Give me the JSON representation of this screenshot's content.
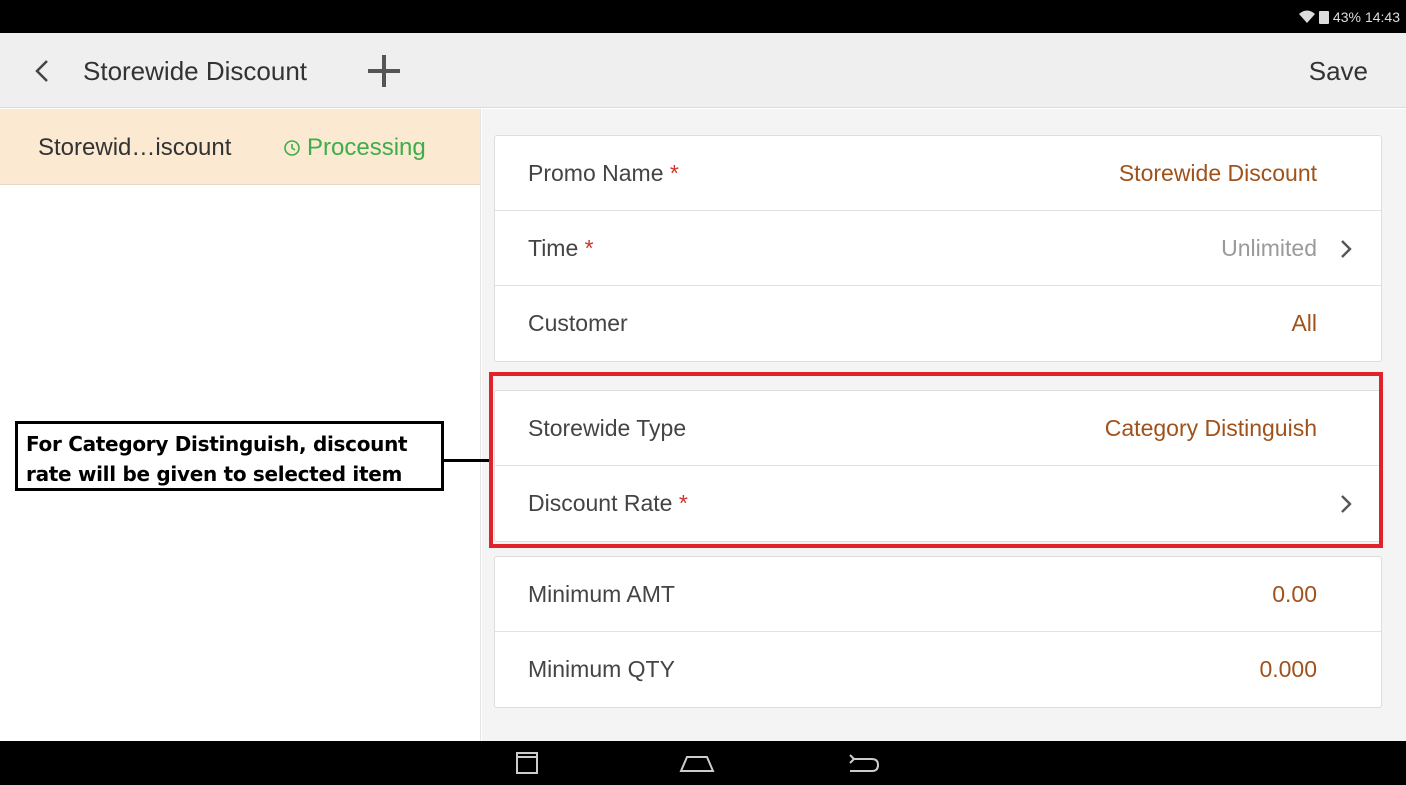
{
  "status_bar": {
    "battery": "43%",
    "time": "14:43"
  },
  "app_bar": {
    "title": "Storewide Discount",
    "save_label": "Save"
  },
  "list": {
    "items": [
      {
        "name": "Storewid…iscount",
        "status": "Processing"
      }
    ]
  },
  "form": {
    "group1": [
      {
        "label": "Promo Name",
        "required": "*",
        "value": "Storewide Discount"
      },
      {
        "label": "Time",
        "required": "*",
        "value": "Unlimited"
      },
      {
        "label": "Customer",
        "required": "",
        "value": "All"
      }
    ],
    "group2": [
      {
        "label": "Storewide Type",
        "required": "",
        "value": "Category Distinguish"
      },
      {
        "label": "Discount Rate",
        "required": "*",
        "value": ""
      }
    ],
    "group3": [
      {
        "label": "Minimum AMT",
        "required": "",
        "value": "0.00"
      },
      {
        "label": "Minimum QTY",
        "required": "",
        "value": "0.000"
      }
    ]
  },
  "annotation": {
    "line1": "For Category Distinguish, discount",
    "line2": "rate will be given to selected item"
  },
  "colors": {
    "value_text": "#a0521a",
    "processing": "#3dae4a",
    "required": "#d0312d",
    "highlight": "#e0222c",
    "selected_row": "#fbe9d2"
  },
  "icons": [
    "wifi-icon",
    "battery-icon",
    "back-icon",
    "plus-icon",
    "clock-icon",
    "chevron-right-icon",
    "recents-icon",
    "home-icon",
    "back-nav-icon"
  ]
}
